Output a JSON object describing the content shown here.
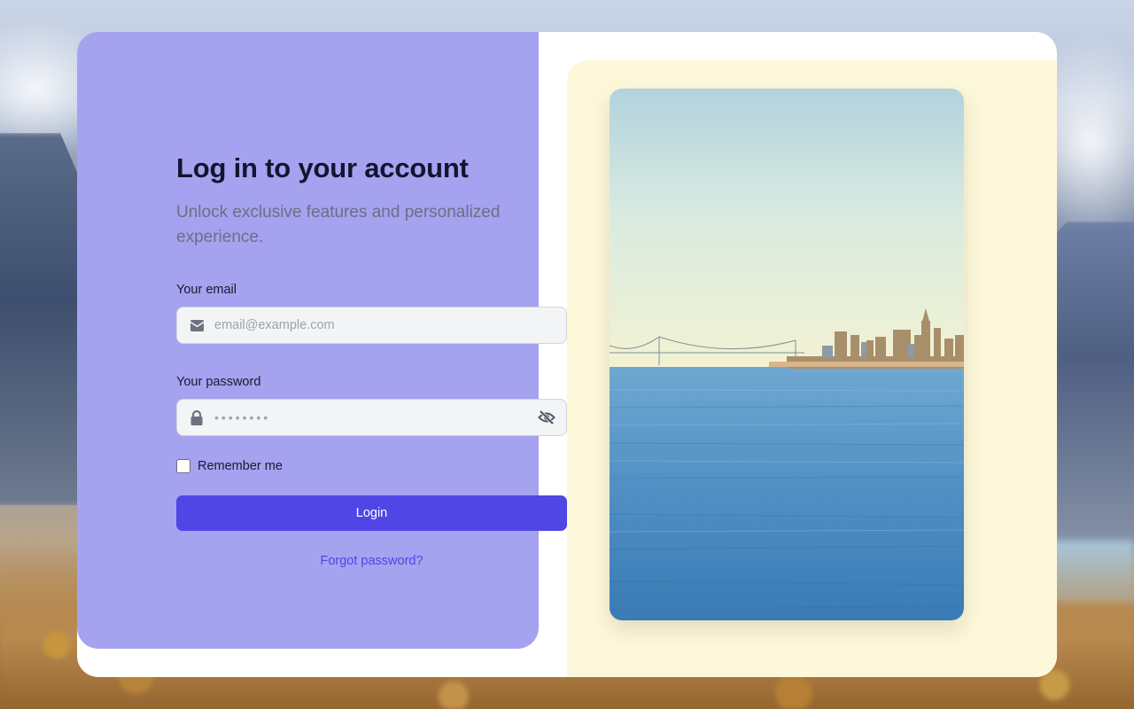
{
  "login": {
    "title": "Log in to your account",
    "subtitle": "Unlock exclusive features and personalized experience.",
    "email": {
      "label": "Your email",
      "placeholder": "email@example.com",
      "icon": "envelope-icon"
    },
    "password": {
      "label": "Your password",
      "masked_value": "••••••••",
      "icon": "lock-icon",
      "toggle_icon": "eye-off-icon"
    },
    "remember_label": "Remember me",
    "remember_checked": false,
    "login_label": "Login",
    "forgot_label": "Forgot password?"
  },
  "colors": {
    "left_panel": "#a5a2f0",
    "right_panel": "#fef8da",
    "primary": "#4f46e5",
    "title_text": "#141430",
    "subtitle_text": "#6b6f85"
  },
  "image": {
    "subject": "city-skyline-over-water-photo"
  }
}
